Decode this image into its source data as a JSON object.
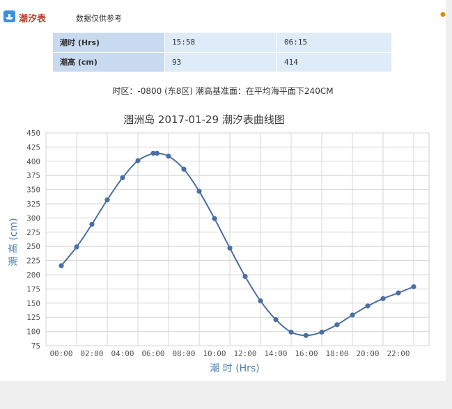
{
  "header": {
    "title": "潮汐表",
    "subtitle": "数据仅供参考",
    "icon": "ship-icon",
    "accent": "#c0392b",
    "icon_color": "#3c8fd8"
  },
  "table": {
    "rows": [
      {
        "label": "潮时 (Hrs)",
        "values": [
          "15:58",
          "06:15"
        ]
      },
      {
        "label": "潮高 (cm)",
        "values": [
          "93",
          "414"
        ]
      }
    ]
  },
  "note": "时区：-0800 (东8区) 潮高基准面：在平均海平面下240CM",
  "chart_data": {
    "type": "line",
    "title": "涠洲岛 2017-01-29 潮汐表曲线图",
    "xlabel": "潮 时 (Hrs)",
    "ylabel": "潮 高 (cm)",
    "ylim": [
      75,
      450
    ],
    "yticks": [
      75,
      100,
      125,
      150,
      175,
      200,
      225,
      250,
      275,
      300,
      325,
      350,
      375,
      400,
      425,
      450
    ],
    "xlim": [
      -1,
      24
    ],
    "xticks": [
      0,
      2,
      4,
      6,
      8,
      10,
      12,
      14,
      16,
      18,
      20,
      22
    ],
    "xtick_labels": [
      "00:00",
      "02:00",
      "04:00",
      "06:00",
      "08:00",
      "10:00",
      "12:00",
      "14:00",
      "16:00",
      "18:00",
      "20:00",
      "22:00"
    ],
    "grid": true,
    "line_color": "#4a6fa5",
    "points": [
      [
        0,
        216
      ],
      [
        1,
        249
      ],
      [
        2,
        289
      ],
      [
        3,
        332
      ],
      [
        4,
        371
      ],
      [
        5,
        401
      ],
      [
        6,
        414
      ],
      [
        6.25,
        414
      ],
      [
        7,
        409
      ],
      [
        8,
        386
      ],
      [
        9,
        347
      ],
      [
        10,
        299
      ],
      [
        11,
        247
      ],
      [
        12,
        197
      ],
      [
        13,
        154
      ],
      [
        14,
        121
      ],
      [
        15,
        99
      ],
      [
        15.97,
        93
      ],
      [
        17,
        99
      ],
      [
        18,
        112
      ],
      [
        19,
        129
      ],
      [
        20,
        145
      ],
      [
        21,
        158
      ],
      [
        22,
        168
      ],
      [
        23,
        179
      ]
    ]
  }
}
